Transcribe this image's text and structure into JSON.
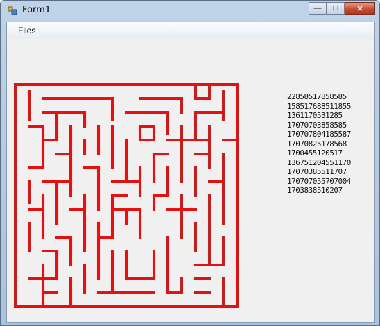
{
  "window": {
    "title": "Form1",
    "controls": {
      "minimize": "—",
      "maximize": "□",
      "close": "✕"
    }
  },
  "menu": {
    "items": [
      {
        "label": "Files"
      }
    ]
  },
  "maze": {
    "color": "#e41111"
  },
  "number_lines": [
    "22858517858585",
    "158517688511855",
    "1361170531285",
    "17070703858585",
    "170707804185587",
    "17070825178568",
    "1700455120517",
    "136751204551170",
    "17070385511707",
    "170707055707004",
    "1703838510207"
  ]
}
